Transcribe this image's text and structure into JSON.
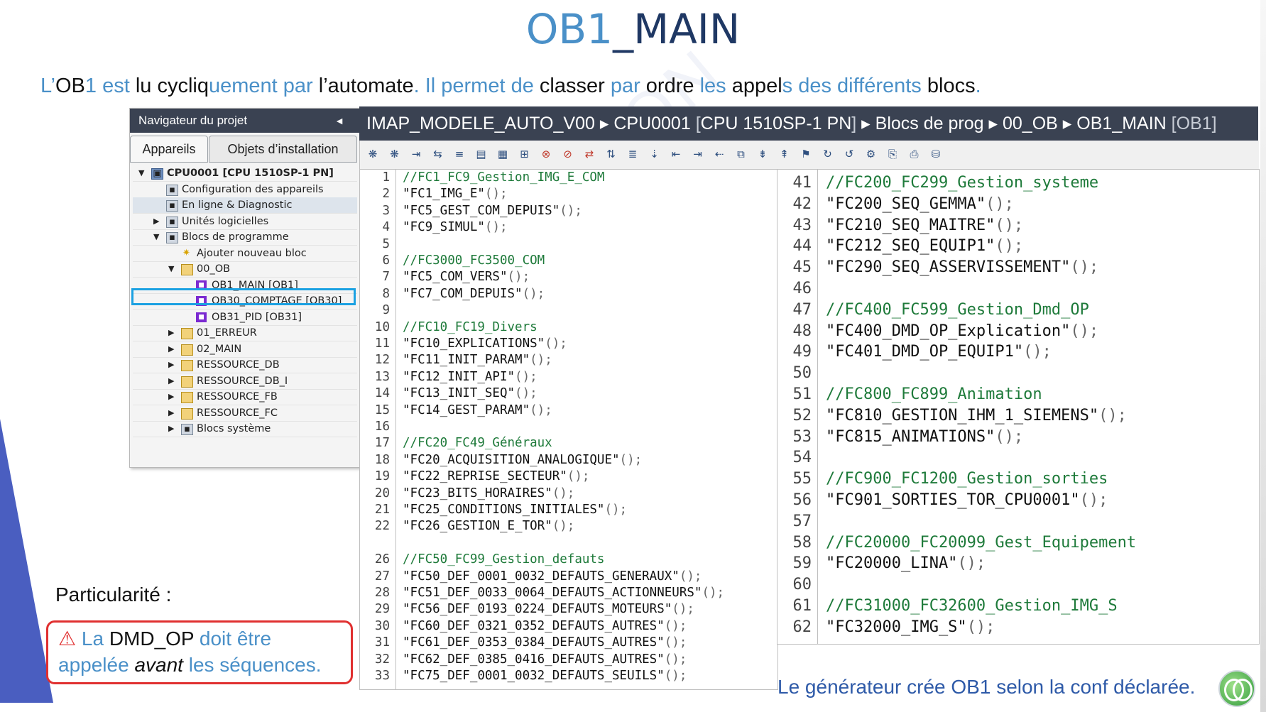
{
  "slide": {
    "title_a": "OB1",
    "title_b": "_MAIN",
    "subtitle": [
      {
        "t": "L’",
        "c": "sc"
      },
      {
        "t": "OB",
        "c": "sk"
      },
      {
        "t": "1",
        "c": "sc"
      },
      {
        "t": " est ",
        "c": "sc"
      },
      {
        "t": "lu cycliq",
        "c": "sk"
      },
      {
        "t": "uement par ",
        "c": "sc"
      },
      {
        "t": "l’",
        "c": "sk"
      },
      {
        "t": "automate",
        "c": "sk"
      },
      {
        "t": ". Il permet de ",
        "c": "sc"
      },
      {
        "t": "classer ",
        "c": "sk"
      },
      {
        "t": "par ",
        "c": "sc"
      },
      {
        "t": "ordre ",
        "c": "sk"
      },
      {
        "t": "les ",
        "c": "sc"
      },
      {
        "t": "appel",
        "c": "sk"
      },
      {
        "t": "s des différents ",
        "c": "sc"
      },
      {
        "t": "blocs",
        "c": "sk"
      },
      {
        "t": ".",
        "c": "sc"
      }
    ],
    "particularite": "Particularité :",
    "warn_icon": "⚠",
    "warn_line1": [
      {
        "t": " La ",
        "c": "sc"
      },
      {
        "t": "DMD_OP ",
        "c": "sk"
      },
      {
        "t": "doit être",
        "c": "sc"
      }
    ],
    "warn_line2": [
      {
        "t": "appelée ",
        "c": "sc"
      },
      {
        "t": "avant ",
        "c": "ski"
      },
      {
        "t": "les ",
        "c": "sc"
      },
      {
        "t": "séquences.",
        "c": "mix"
      }
    ],
    "footer": "Le générateur crée OB1 selon la conf déclarée.",
    "watermark": "AEI FORMATION"
  },
  "navigator": {
    "title": "Navigateur du projet",
    "collapse": "◄",
    "tabs": [
      "Appareils",
      "Objets d’installation"
    ],
    "tree": [
      {
        "label": "CPU0001 [CPU 1510SP-1 PN]",
        "level": 0,
        "arrow": "▼",
        "icon": "cpu",
        "bold": true
      },
      {
        "label": "Configuration des appareils",
        "level": 1,
        "arrow": "",
        "icon": "gen"
      },
      {
        "label": "En ligne & Diagnostic",
        "level": 1,
        "arrow": "",
        "icon": "gen",
        "hl": true
      },
      {
        "label": "Unités logicielles",
        "level": 1,
        "arrow": "▶",
        "icon": "gen"
      },
      {
        "label": "Blocs de programme",
        "level": 1,
        "arrow": "▼",
        "icon": "gen"
      },
      {
        "label": "Ajouter nouveau bloc",
        "level": 2,
        "arrow": "",
        "icon": "star"
      },
      {
        "label": "00_OB",
        "level": 2,
        "arrow": "▼",
        "icon": "folder"
      },
      {
        "label": "OB1_MAIN [OB1]",
        "level": 3,
        "arrow": "",
        "icon": "block",
        "selected": true
      },
      {
        "label": "OB30_COMPTAGE [OB30]",
        "level": 3,
        "arrow": "",
        "icon": "block"
      },
      {
        "label": "OB31_PID [OB31]",
        "level": 3,
        "arrow": "",
        "icon": "block"
      },
      {
        "label": "01_ERREUR",
        "level": 2,
        "arrow": "▶",
        "icon": "folder"
      },
      {
        "label": "02_MAIN",
        "level": 2,
        "arrow": "▶",
        "icon": "folder"
      },
      {
        "label": "RESSOURCE_DB",
        "level": 2,
        "arrow": "▶",
        "icon": "folder"
      },
      {
        "label": "RESSOURCE_DB_I",
        "level": 2,
        "arrow": "▶",
        "icon": "folder"
      },
      {
        "label": "RESSOURCE_FB",
        "level": 2,
        "arrow": "▶",
        "icon": "folder"
      },
      {
        "label": "RESSOURCE_FC",
        "level": 2,
        "arrow": "▶",
        "icon": "folder"
      },
      {
        "label": "Blocs système",
        "level": 2,
        "arrow": "▶",
        "icon": "gen"
      }
    ]
  },
  "editor": {
    "breadcrumb": [
      {
        "t": "IMAP_MODELE_AUTO_V00",
        "d": false
      },
      {
        "t": " ▸ ",
        "d": false
      },
      {
        "t": "CPU0001 ",
        "d": false
      },
      {
        "t": "[",
        "d": true
      },
      {
        "t": "CPU 1510SP-1 PN",
        "d": false
      },
      {
        "t": "]",
        "d": true
      },
      {
        "t": " ▸ ",
        "d": false
      },
      {
        "t": "Blocs de prog",
        "d": false
      },
      {
        "t": " ▸ ",
        "d": false
      },
      {
        "t": "00_OB",
        "d": false
      },
      {
        "t": " ▸ ",
        "d": false
      },
      {
        "t": "OB1_MAIN ",
        "d": false
      },
      {
        "t": "[OB1]",
        "d": true
      }
    ],
    "toolbar_icons": [
      "❋",
      "❋",
      "⇥",
      "⇆",
      "≡",
      "▤",
      "▦",
      "⊞",
      "⊗",
      "⊘",
      "⇄",
      "⇅",
      "≣",
      "⇣",
      "⇤",
      "⇥",
      "⇠",
      "⧉",
      "⇟",
      "⇞",
      "⚑",
      "↻",
      "↺",
      "⚙",
      "⎘",
      "⎙",
      "⛁"
    ],
    "left_code": [
      {
        "n": "1",
        "t": "//FC1_FC9_Gestion_IMG_E_COM",
        "cm": true
      },
      {
        "n": "2",
        "t": "\"FC1_IMG_E\"",
        "s": "();"
      },
      {
        "n": "3",
        "t": "\"FC5_GEST_COM_DEPUIS\"",
        "s": "();"
      },
      {
        "n": "4",
        "t": "\"FC9_SIMUL\"",
        "s": "();"
      },
      {
        "n": "5",
        "t": ""
      },
      {
        "n": "6",
        "t": "//FC3000_FC3500_COM",
        "cm": true
      },
      {
        "n": "7",
        "t": "\"FC5_COM_VERS\"",
        "s": "();"
      },
      {
        "n": "8",
        "t": "\"FC7_COM_DEPUIS\"",
        "s": "();"
      },
      {
        "n": "9",
        "t": ""
      },
      {
        "n": "10",
        "t": "//FC10_FC19_Divers",
        "cm": true
      },
      {
        "n": "11",
        "t": "\"FC10_EXPLICATIONS\"",
        "s": "();"
      },
      {
        "n": "12",
        "t": "\"FC11_INIT_PARAM\"",
        "s": "();"
      },
      {
        "n": "13",
        "t": "\"FC12_INIT_API\"",
        "s": "();"
      },
      {
        "n": "14",
        "t": "\"FC13_INIT_SEQ\"",
        "s": "();"
      },
      {
        "n": "15",
        "t": "\"FC14_GEST_PARAM\"",
        "s": "();"
      },
      {
        "n": "16",
        "t": ""
      },
      {
        "n": "17",
        "t": "//FC20_FC49_Généraux",
        "cm": true
      },
      {
        "n": "18",
        "t": "\"FC20_ACQUISITION_ANALOGIQUE\"",
        "s": "();"
      },
      {
        "n": "19",
        "t": "\"FC22_REPRISE_SECTEUR\"",
        "s": "();"
      },
      {
        "n": "20",
        "t": "\"FC23_BITS_HORAIRES\"",
        "s": "();"
      },
      {
        "n": "21",
        "t": "\"FC25_CONDITIONS_INITIALES\"",
        "s": "();"
      },
      {
        "n": "22",
        "t": "\"FC26_GESTION_E_TOR\"",
        "s": "();"
      },
      {
        "n": "",
        "t": ""
      },
      {
        "n": "26",
        "t": "//FC50_FC99_Gestion_defauts",
        "cm": true
      },
      {
        "n": "27",
        "t": "\"FC50_DEF_0001_0032_DEFAUTS_GENERAUX\"",
        "s": "();"
      },
      {
        "n": "28",
        "t": "\"FC51_DEF_0033_0064_DEFAUTS_ACTIONNEURS\"",
        "s": "();"
      },
      {
        "n": "29",
        "t": "\"FC56_DEF_0193_0224_DEFAUTS_MOTEURS\"",
        "s": "();"
      },
      {
        "n": "30",
        "t": "\"FC60_DEF_0321_0352_DEFAUTS_AUTRES\"",
        "s": "();"
      },
      {
        "n": "31",
        "t": "\"FC61_DEF_0353_0384_DEFAUTS_AUTRES\"",
        "s": "();"
      },
      {
        "n": "32",
        "t": "\"FC62_DEF_0385_0416_DEFAUTS_AUTRES\"",
        "s": "();"
      },
      {
        "n": "33",
        "t": "\"FC75_DEF_0001_0032_DEFAUTS_SEUILS\"",
        "s": "();"
      }
    ],
    "right_code": [
      {
        "n": "41",
        "t": "//FC200_FC299_Gestion_systeme",
        "cm": true
      },
      {
        "n": "42",
        "t": "\"FC200_SEQ_GEMMA\"",
        "s": "();"
      },
      {
        "n": "43",
        "t": "\"FC210_SEQ_MAITRE\"",
        "s": "();"
      },
      {
        "n": "44",
        "t": "\"FC212_SEQ_EQUIP1\"",
        "s": "();"
      },
      {
        "n": "45",
        "t": "\"FC290_SEQ_ASSERVISSEMENT\"",
        "s": "();"
      },
      {
        "n": "46",
        "t": ""
      },
      {
        "n": "47",
        "t": "//FC400_FC599_Gestion_Dmd_OP",
        "cm": true
      },
      {
        "n": "48",
        "t": "\"FC400_DMD_OP_Explication\"",
        "s": "();"
      },
      {
        "n": "49",
        "t": "\"FC401_DMD_OP_EQUIP1\"",
        "s": "();"
      },
      {
        "n": "50",
        "t": ""
      },
      {
        "n": "51",
        "t": "//FC800_FC899_Animation",
        "cm": true
      },
      {
        "n": "52",
        "t": "\"FC810_GESTION_IHM_1_SIEMENS\"",
        "s": "();"
      },
      {
        "n": "53",
        "t": "\"FC815_ANIMATIONS\"",
        "s": "();"
      },
      {
        "n": "54",
        "t": ""
      },
      {
        "n": "55",
        "t": "//FC900_FC1200_Gestion_sorties",
        "cm": true
      },
      {
        "n": "56",
        "t": "\"FC901_SORTIES_TOR_CPU0001\"",
        "s": "();"
      },
      {
        "n": "57",
        "t": ""
      },
      {
        "n": "58",
        "t": "//FC20000_FC20099_Gest_Equipement",
        "cm": true
      },
      {
        "n": "59",
        "t": "\"FC20000_LINA\"",
        "s": "();"
      },
      {
        "n": "60",
        "t": ""
      },
      {
        "n": "61",
        "t": "//FC31000_FC32600_Gestion_IMG_S",
        "cm": true
      },
      {
        "n": "62",
        "t": "\"FC32000_IMG_S\"",
        "s": "();"
      }
    ]
  }
}
